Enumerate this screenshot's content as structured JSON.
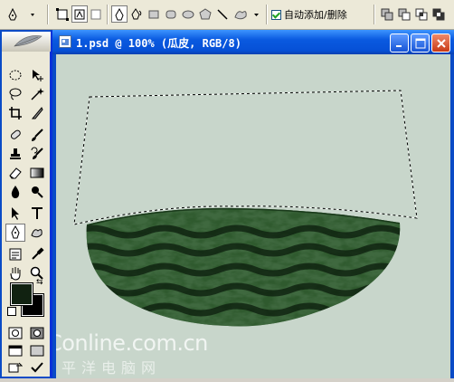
{
  "options_bar": {
    "auto_add_label": "自动添加/删除"
  },
  "document": {
    "title": "1.psd @ 100% (瓜皮, RGB/8)"
  },
  "watermark": {
    "line1": "PConline.com.cn",
    "line2": "太平洋电脑网"
  },
  "colors": {
    "foreground": "#112211",
    "background": "#000000",
    "canvas": "#c8d6cb",
    "rind_dark": "#0d230f",
    "rind_light": "#2e5a2c",
    "titlebar": "#0a5ae0"
  }
}
